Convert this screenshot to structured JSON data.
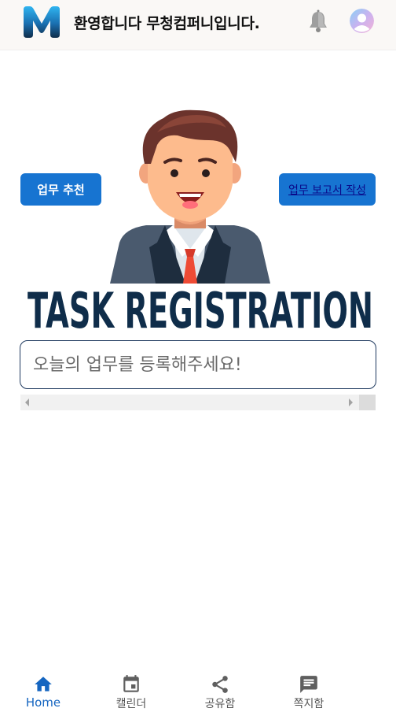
{
  "header": {
    "welcome_text": "환영합니다 무청컴퍼니입니다.",
    "logo_icon": "m-logo-icon",
    "bell_icon": "bell-icon",
    "avatar_icon": "avatar-icon"
  },
  "actions": {
    "recommend_label": "업무 추천",
    "report_label": "업무 보고서 작성"
  },
  "hero": {
    "title": "TASK REGISTRATION",
    "illustration": "businessman-illustration"
  },
  "task_input": {
    "placeholder": "오늘의 업무를 등록해주세요!",
    "value": ""
  },
  "bottom_nav": {
    "items": [
      {
        "label": "Home",
        "icon": "home-icon",
        "active": true
      },
      {
        "label": "캘린더",
        "icon": "calendar-icon",
        "active": false
      },
      {
        "label": "공유함",
        "icon": "share-icon",
        "active": false
      },
      {
        "label": "쪽지함",
        "icon": "message-icon",
        "active": false
      }
    ]
  },
  "colors": {
    "primary": "#1774d1",
    "title_navy": "#0f2d4a",
    "active_nav": "#1565c0",
    "inactive_nav": "#555555"
  }
}
